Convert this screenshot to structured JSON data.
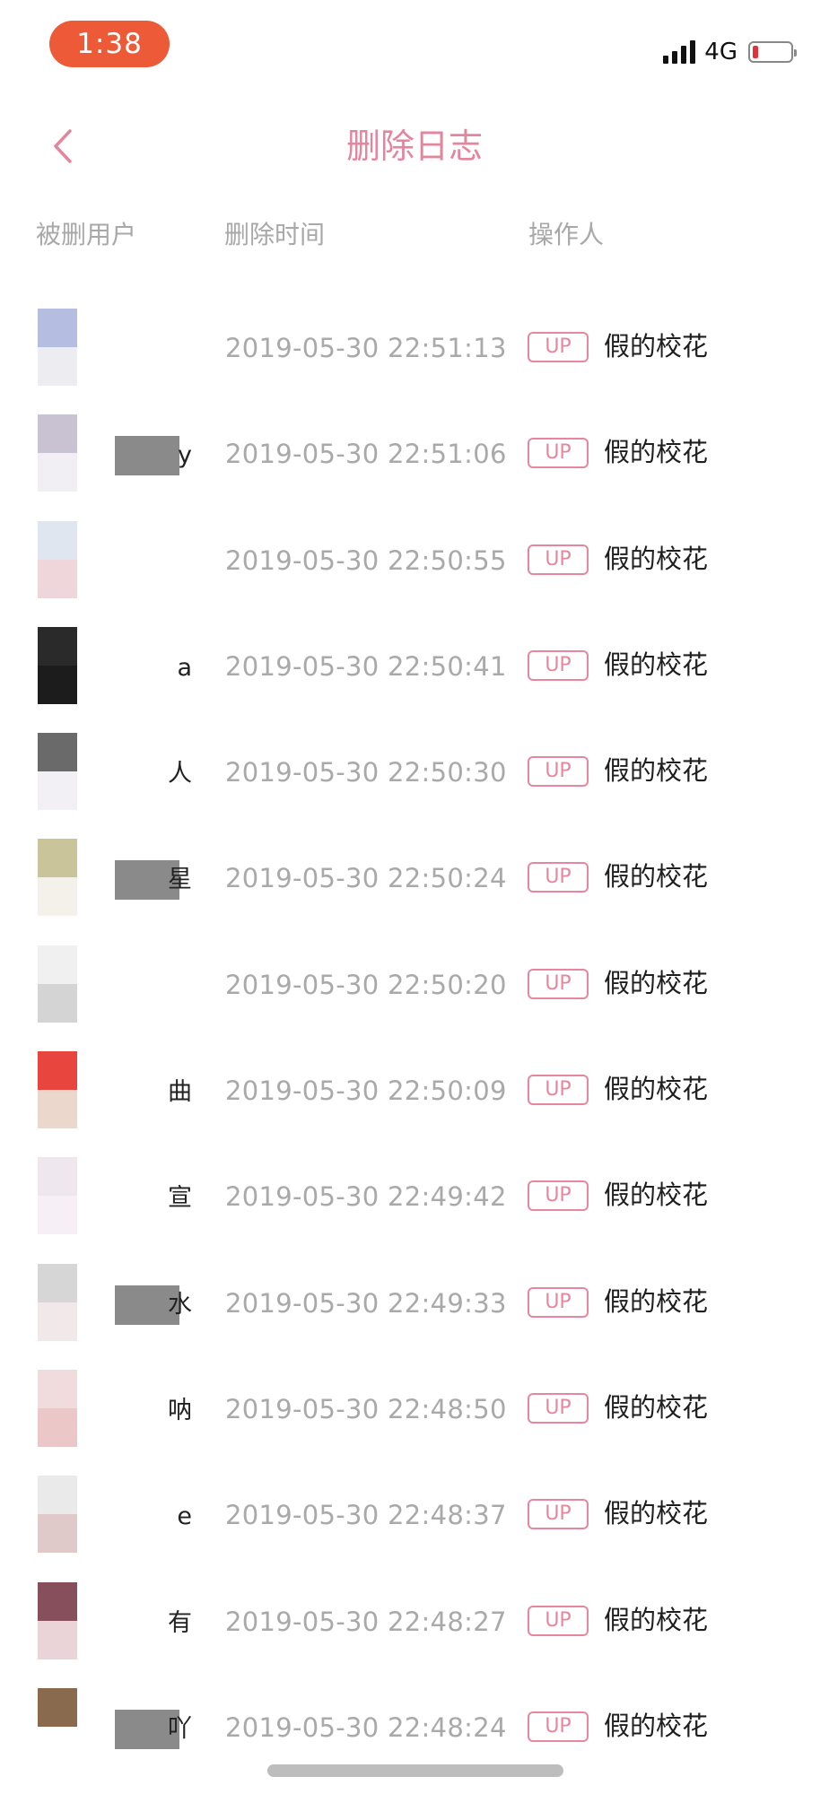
{
  "status_bar": {
    "time": "1:38",
    "network": "4G"
  },
  "nav": {
    "title": "删除日志"
  },
  "columns": {
    "deleted_user": "被删用户",
    "delete_time": "删除时间",
    "operator": "操作人"
  },
  "colors": {
    "accent": "#e3859d",
    "status_pill": "#ec5a37"
  },
  "rows": [
    {
      "user": "",
      "time": "2019-05-30 22:51:13",
      "badge": "UP",
      "operator": "假的校花"
    },
    {
      "user": "y",
      "time": "2019-05-30 22:51:06",
      "badge": "UP",
      "operator": "假的校花"
    },
    {
      "user": "",
      "time": "2019-05-30 22:50:55",
      "badge": "UP",
      "operator": "假的校花"
    },
    {
      "user": "a",
      "time": "2019-05-30 22:50:41",
      "badge": "UP",
      "operator": "假的校花"
    },
    {
      "user": "人",
      "time": "2019-05-30 22:50:30",
      "badge": "UP",
      "operator": "假的校花"
    },
    {
      "user": "星",
      "time": "2019-05-30 22:50:24",
      "badge": "UP",
      "operator": "假的校花"
    },
    {
      "user": "",
      "time": "2019-05-30 22:50:20",
      "badge": "UP",
      "operator": "假的校花"
    },
    {
      "user": "曲",
      "time": "2019-05-30 22:50:09",
      "badge": "UP",
      "operator": "假的校花"
    },
    {
      "user": "宣",
      "time": "2019-05-30 22:49:42",
      "badge": "UP",
      "operator": "假的校花"
    },
    {
      "user": "水",
      "time": "2019-05-30 22:49:33",
      "badge": "UP",
      "operator": "假的校花"
    },
    {
      "user": "呐",
      "time": "2019-05-30 22:48:50",
      "badge": "UP",
      "operator": "假的校花"
    },
    {
      "user": "e",
      "time": "2019-05-30 22:48:37",
      "badge": "UP",
      "operator": "假的校花"
    },
    {
      "user": "有",
      "time": "2019-05-30 22:48:27",
      "badge": "UP",
      "operator": "假的校花"
    },
    {
      "user": "吖",
      "time": "2019-05-30 22:48:24",
      "badge": "UP",
      "operator": "假的校花"
    }
  ]
}
